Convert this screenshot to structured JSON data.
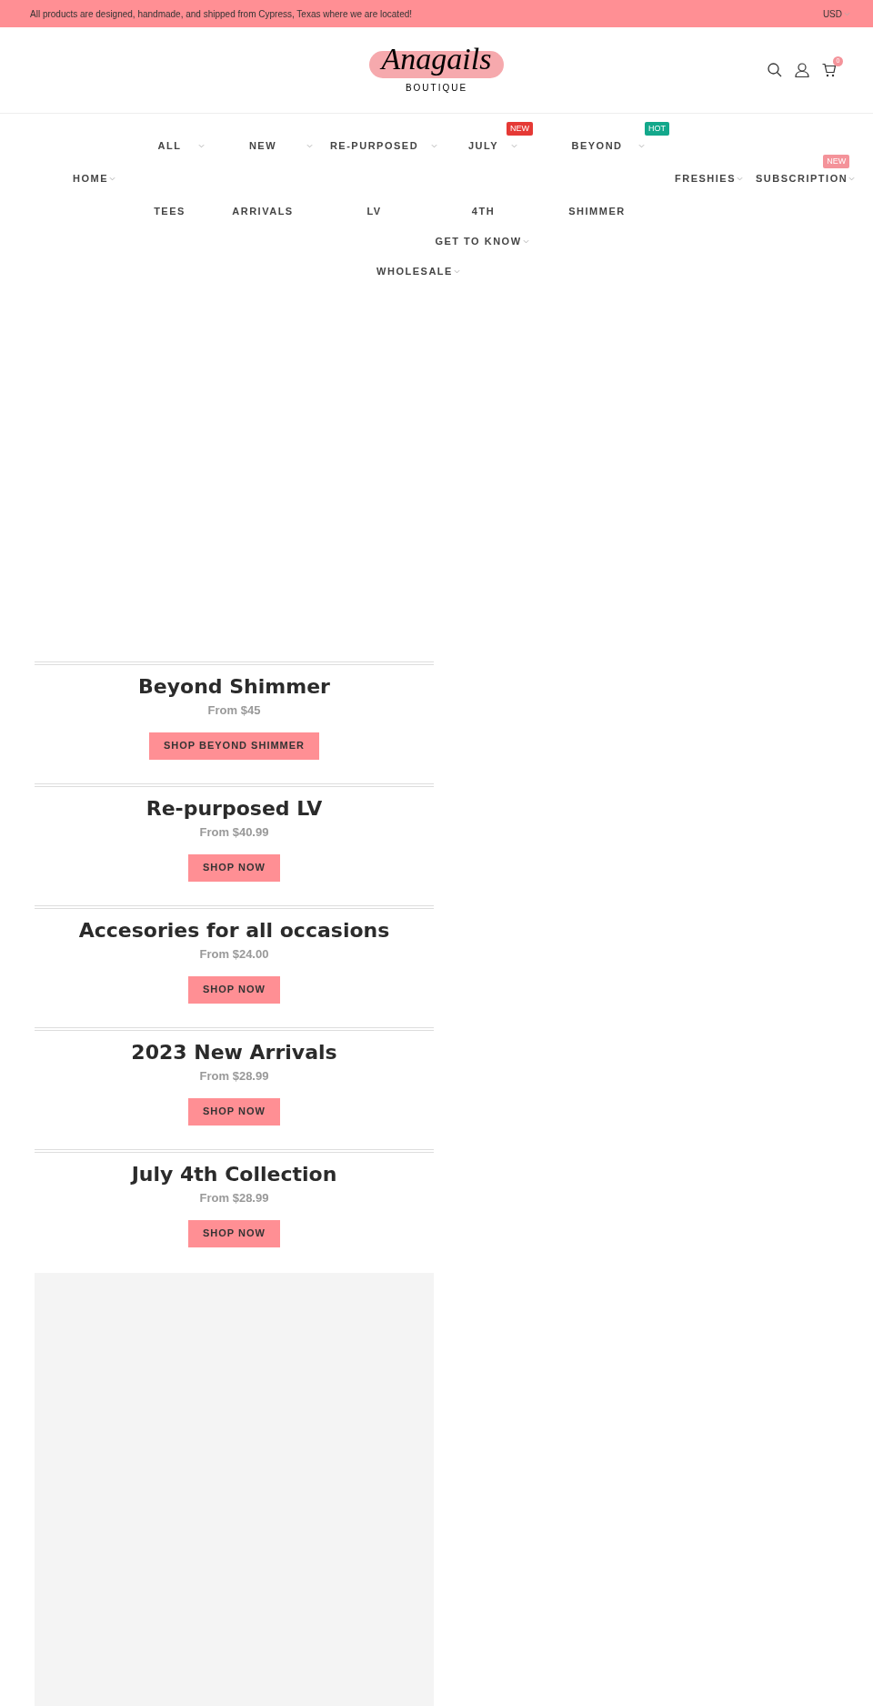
{
  "announcement": {
    "text": "All products are designed, handmade, and shipped from Cypress, Texas where we are located!",
    "currency": "USD"
  },
  "logo": {
    "name": "Anagails",
    "tagline": "BOUTIQUE"
  },
  "cart": {
    "count": "0"
  },
  "nav": {
    "left": [
      {
        "label": "HOME"
      }
    ],
    "middle": [
      {
        "label": "ALL TEES"
      },
      {
        "label": "NEW ARRIVALS"
      },
      {
        "label": "RE-PURPOSED LV"
      },
      {
        "label": "JULY 4TH",
        "badge": {
          "text": "NEW",
          "color": "#e53935"
        }
      },
      {
        "label": "BEYOND SHIMMER",
        "badge": {
          "text": "HOT",
          "color": "#13a88b"
        }
      }
    ],
    "right": [
      {
        "label": "FRESHIES"
      },
      {
        "label": "SUBSCRIPTION",
        "badge": {
          "text": "NEW",
          "color": "#f4939a"
        }
      }
    ],
    "second_row": [
      {
        "label": "GET TO KNOW"
      }
    ],
    "third_row": [
      {
        "label": "WHOLESALE"
      }
    ]
  },
  "collections": [
    {
      "title": "Beyond Shimmer",
      "price": "From $45",
      "button": "SHOP BEYOND SHIMMER"
    },
    {
      "title": "Re-purposed LV",
      "price": "From $40.99",
      "button": "SHOP NOW"
    },
    {
      "title": "Accesories for all occasions",
      "price": "From $24.00",
      "button": "SHOP NOW"
    },
    {
      "title": "2023 New Arrivals",
      "price": "From $28.99",
      "button": "SHOP NOW"
    },
    {
      "title": "July 4th Collection",
      "price": "From $28.99",
      "button": "SHOP NOW"
    }
  ]
}
